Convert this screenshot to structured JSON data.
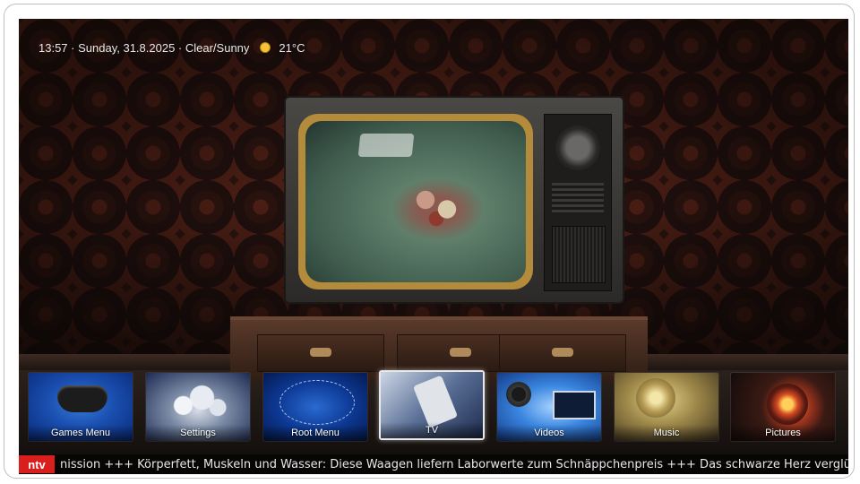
{
  "status_bar": {
    "time": "13:57",
    "separator": " · ",
    "date": "Sunday, 31.8.2025",
    "weather": "Clear/Sunny",
    "temperature": "21°C",
    "weather_icon": "sun-icon"
  },
  "menu": {
    "items": [
      {
        "label": "Games Menu",
        "icon": "gamepad-icon",
        "focused": false
      },
      {
        "label": "Settings",
        "icon": "gears-icon",
        "focused": false
      },
      {
        "label": "Root Menu",
        "icon": "network-icon",
        "focused": false
      },
      {
        "label": "TV",
        "icon": "remote-icon",
        "focused": true
      },
      {
        "label": "Videos",
        "icon": "film-reel-icon",
        "focused": false
      },
      {
        "label": "Music",
        "icon": "treble-knob-icon",
        "focused": false
      },
      {
        "label": "Pictures",
        "icon": "camera-lens-icon",
        "focused": false
      }
    ]
  },
  "ticker": {
    "logo_text": "ntv",
    "text": "nission +++ Körperfett, Muskeln und Wasser: Diese Waagen liefern Laborwerte zum Schnäppchenpreis +++ Das schwarze Herz verglüht: F"
  },
  "colors": {
    "ntv_red": "#d91e1e",
    "focus_border": "#e9e9e9",
    "weather_icon": "#f7c33a"
  }
}
